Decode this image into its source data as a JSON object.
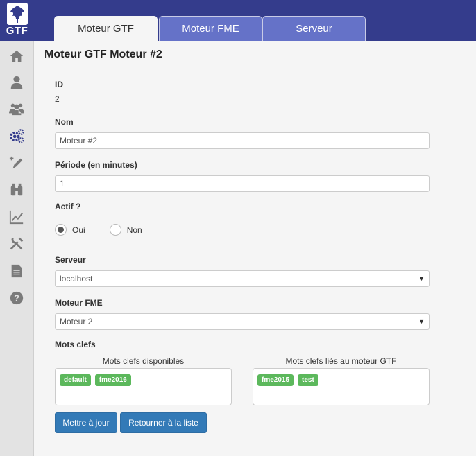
{
  "app": {
    "logo_text": "GTF"
  },
  "tabs": [
    {
      "label": "Moteur GTF",
      "active": true
    },
    {
      "label": "Moteur FME",
      "active": false
    },
    {
      "label": "Serveur",
      "active": false
    }
  ],
  "sidebar_icons": [
    "home-icon",
    "user-icon",
    "users-icon",
    "gears-icon",
    "edit-icon",
    "binoculars-icon",
    "chart-icon",
    "tools-icon",
    "document-icon",
    "help-icon"
  ],
  "form": {
    "title": "Moteur GTF Moteur #2",
    "id_label": "ID",
    "id_value": "2",
    "nom_label": "Nom",
    "nom_value": "Moteur #2",
    "periode_label": "Période (en minutes)",
    "periode_value": "1",
    "actif_label": "Actif ?",
    "actif_options": [
      {
        "label": "Oui",
        "checked": true
      },
      {
        "label": "Non",
        "checked": false
      }
    ],
    "serveur_label": "Serveur",
    "serveur_value": "localhost",
    "moteur_fme_label": "Moteur FME",
    "moteur_fme_value": "Moteur 2",
    "mots_clefs_label": "Mots clefs",
    "available_title": "Mots clefs disponibles",
    "available_tags": [
      "default",
      "fme2016"
    ],
    "linked_title": "Mots clefs liés au moteur GTF",
    "linked_tags": [
      "fme2015",
      "test"
    ]
  },
  "buttons": {
    "save": "Mettre à jour",
    "back": "Retourner à la liste"
  },
  "colors": {
    "header": "#343c8c",
    "tab_inactive": "#6572c8",
    "tag": "#5cb85c",
    "button": "#337ab7"
  }
}
